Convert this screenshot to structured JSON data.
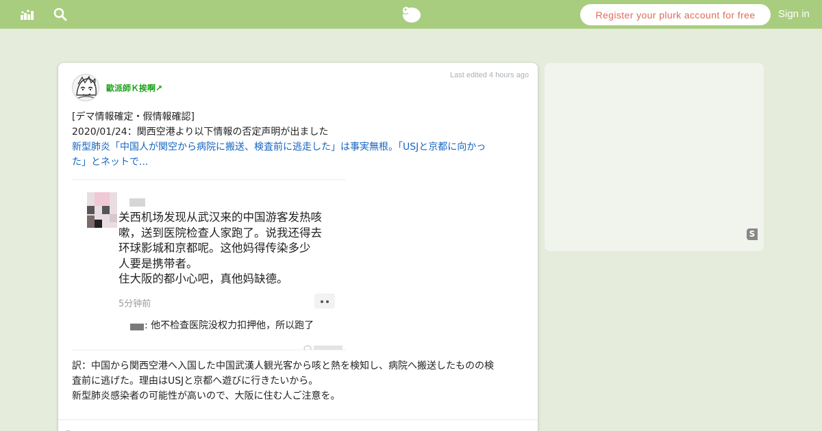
{
  "header": {
    "register_label": "Register your plurk account for free",
    "signin_label": "Sign in",
    "icons": [
      "stats-icon",
      "search-icon",
      "plurk-logo"
    ]
  },
  "post": {
    "username": "歐派師Ｋ挨啊↗",
    "timestamp": "Last edited 4 hours ago",
    "lines": [
      "[デマ情報確定・假情報確認]",
      "2020/01/24：関西空港より以下情報の否定声明が出ました"
    ],
    "link_lines": [
      "新型肺炎「中国人が関空から病院に搬送、検査前に逃走した」は事実無根。「USJと京都に向かっ",
      "た」とネットで..."
    ],
    "image": {
      "lines": [
        "关西机场发现从武汉来的中国游客发热咳",
        "嗽，送到医院检查人家跑了。说我还得去",
        "环球影城和京都呢。这他妈得传染多少",
        "人要是携带者。",
        "住大阪的都小心吧，真他妈缺德。"
      ],
      "time": "5分钟前",
      "reply": ": 他不检查医院没权力扣押他，所以跑了"
    },
    "translation": [
      "訳：中国から関西空港へ入国した中国武漢人観光客から咳と熱を検知し、病院へ搬送したものの検",
      "査前に逃げた。理由はUSJと京都へ遊びに行きたいから。",
      "新型肺炎感染者の可能性が高いので、大阪に住む人ご注意を。"
    ]
  },
  "sidebar": {
    "badge": "S"
  },
  "colors": {
    "header_bg": "#a9cd7f",
    "page_bg": "#e5ecdb",
    "register_text": "#e06a5a",
    "username": "#1aa11a",
    "link": "#1565c0"
  }
}
